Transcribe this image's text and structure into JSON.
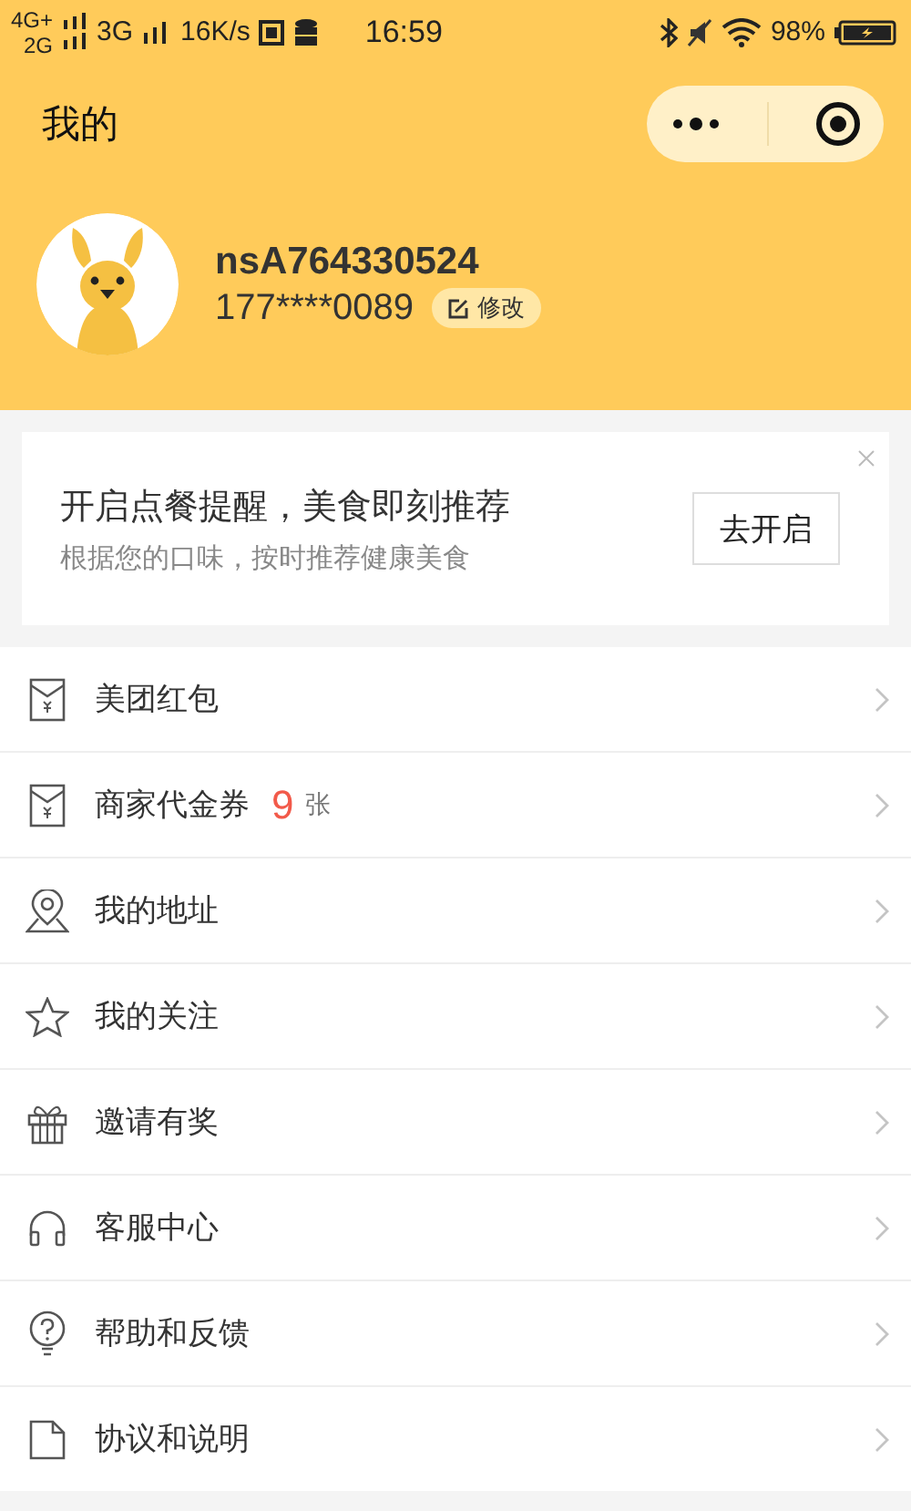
{
  "status_bar": {
    "sim_1": "4G+",
    "sim_2": "2G",
    "network": "3G",
    "speed": "16K/s",
    "time": "16:59",
    "battery": "98%"
  },
  "nav": {
    "title": "我的"
  },
  "profile": {
    "username": "nsA764330524",
    "phone": "177****0089",
    "edit_label": "修改"
  },
  "reminder": {
    "title": "开启点餐提醒，美食即刻推荐",
    "subtitle": "根据您的口味，按时推荐健康美食",
    "button": "去开启"
  },
  "menu": [
    {
      "kind": "redpacket",
      "label": "美团红包"
    },
    {
      "kind": "coupon",
      "label": "商家代金券",
      "count": "9",
      "unit": "张"
    },
    {
      "kind": "address",
      "label": "我的地址"
    },
    {
      "kind": "star",
      "label": "我的关注"
    },
    {
      "kind": "gift",
      "label": "邀请有奖"
    },
    {
      "kind": "headset",
      "label": "客服中心"
    },
    {
      "kind": "help",
      "label": "帮助和反馈"
    },
    {
      "kind": "doc",
      "label": "协议和说明"
    }
  ]
}
